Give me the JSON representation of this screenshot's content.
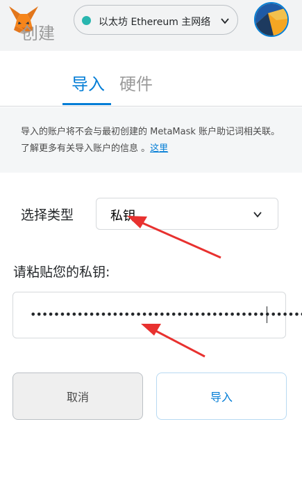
{
  "header": {
    "network": {
      "name": "以太坊 Ethereum 主网络",
      "dot_color": "#29b6af",
      "chevron_icon": "chevron-down-icon"
    },
    "logo_icon": "metamask-fox-icon",
    "avatar_icon": "account-jazzicon"
  },
  "tabs": [
    {
      "label": "创建",
      "active": false
    },
    {
      "label": "导入",
      "active": true
    },
    {
      "label": "硬件",
      "active": false
    }
  ],
  "notice": {
    "text": "导入的账户将不会与最初创建的 MetaMask 账户助记词相关联。了解更多有关导入账户的信息 。",
    "link": "这里"
  },
  "type_select": {
    "label": "选择类型",
    "value": "私钥",
    "chevron_icon": "chevron-down-icon"
  },
  "private_key": {
    "label": "请粘贴您的私钥:",
    "masked_value": "••••••••••••••••••••••••••••••••••••••••••••••••••••••••••••••••"
  },
  "buttons": {
    "cancel": "取消",
    "import": "导入"
  },
  "colors": {
    "accent": "#037dd6",
    "annotation_arrow": "#e8312f",
    "header_bg": "#f2f3f4",
    "notice_bg": "#f4f6f7"
  }
}
